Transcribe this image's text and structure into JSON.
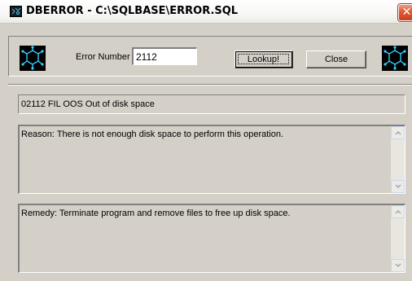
{
  "window": {
    "title": "DBERROR - C:\\SQLBASE\\ERROR.SQL",
    "close_glyph": "✕"
  },
  "toolbar": {
    "error_number_label": "Error Number",
    "error_number_value": "2112",
    "lookup_label": "Lookup!",
    "close_label": "Close"
  },
  "message": {
    "text": "02112 FIL OOS Out of disk space"
  },
  "reason": {
    "text": "Reason: There is not enough disk space to perform this operation."
  },
  "remedy": {
    "text": "Remedy: Terminate program and remove files to free up disk space."
  },
  "icons": {
    "app": "molecule-icon",
    "logo": "molecule-icon",
    "scroll_up": "chevron-up-icon",
    "scroll_down": "chevron-down-icon"
  },
  "colors": {
    "face": "#d4d0c8",
    "logo_bg": "#000000",
    "logo_fg": "#33ccff",
    "close_red": "#de5a35"
  }
}
